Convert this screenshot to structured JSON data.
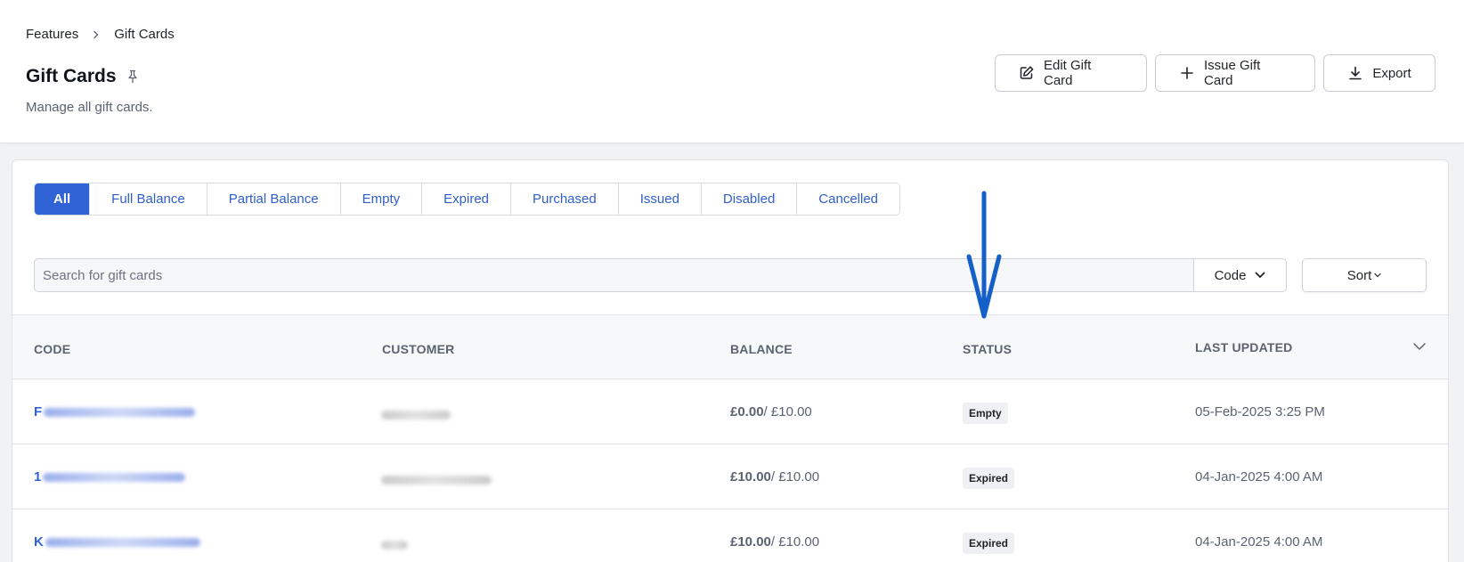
{
  "breadcrumb": {
    "parent": "Features",
    "current": "Gift Cards"
  },
  "page": {
    "title": "Gift Cards",
    "subtitle": "Manage all gift cards."
  },
  "actions": {
    "edit": "Edit Gift Card",
    "issue": "Issue Gift Card",
    "export": "Export"
  },
  "tabs": [
    {
      "label": "All",
      "active": true
    },
    {
      "label": "Full Balance"
    },
    {
      "label": "Partial Balance"
    },
    {
      "label": "Empty"
    },
    {
      "label": "Expired"
    },
    {
      "label": "Purchased"
    },
    {
      "label": "Issued"
    },
    {
      "label": "Disabled"
    },
    {
      "label": "Cancelled"
    }
  ],
  "search": {
    "placeholder": "Search for gift cards",
    "value": "",
    "field": "Code"
  },
  "sort": {
    "label": "Sort"
  },
  "table": {
    "columns": [
      "CODE",
      "CUSTOMER",
      "BALANCE",
      "STATUS",
      "LAST UPDATED"
    ],
    "rows": [
      {
        "code_prefix": "F",
        "balance_current": "£0.00",
        "balance_total": "/ £10.00",
        "status": "Empty",
        "updated": "05-Feb-2025 3:25 PM"
      },
      {
        "code_prefix": "1",
        "balance_current": "£10.00",
        "balance_total": "/ £10.00",
        "status": "Expired",
        "updated": "04-Jan-2025 4:00 AM"
      },
      {
        "code_prefix": "K",
        "balance_current": "£10.00",
        "balance_total": "/ £10.00",
        "status": "Expired",
        "updated": "04-Jan-2025 4:00 AM"
      }
    ]
  },
  "colors": {
    "accent": "#2f63d6",
    "annotation": "#1560c8"
  }
}
